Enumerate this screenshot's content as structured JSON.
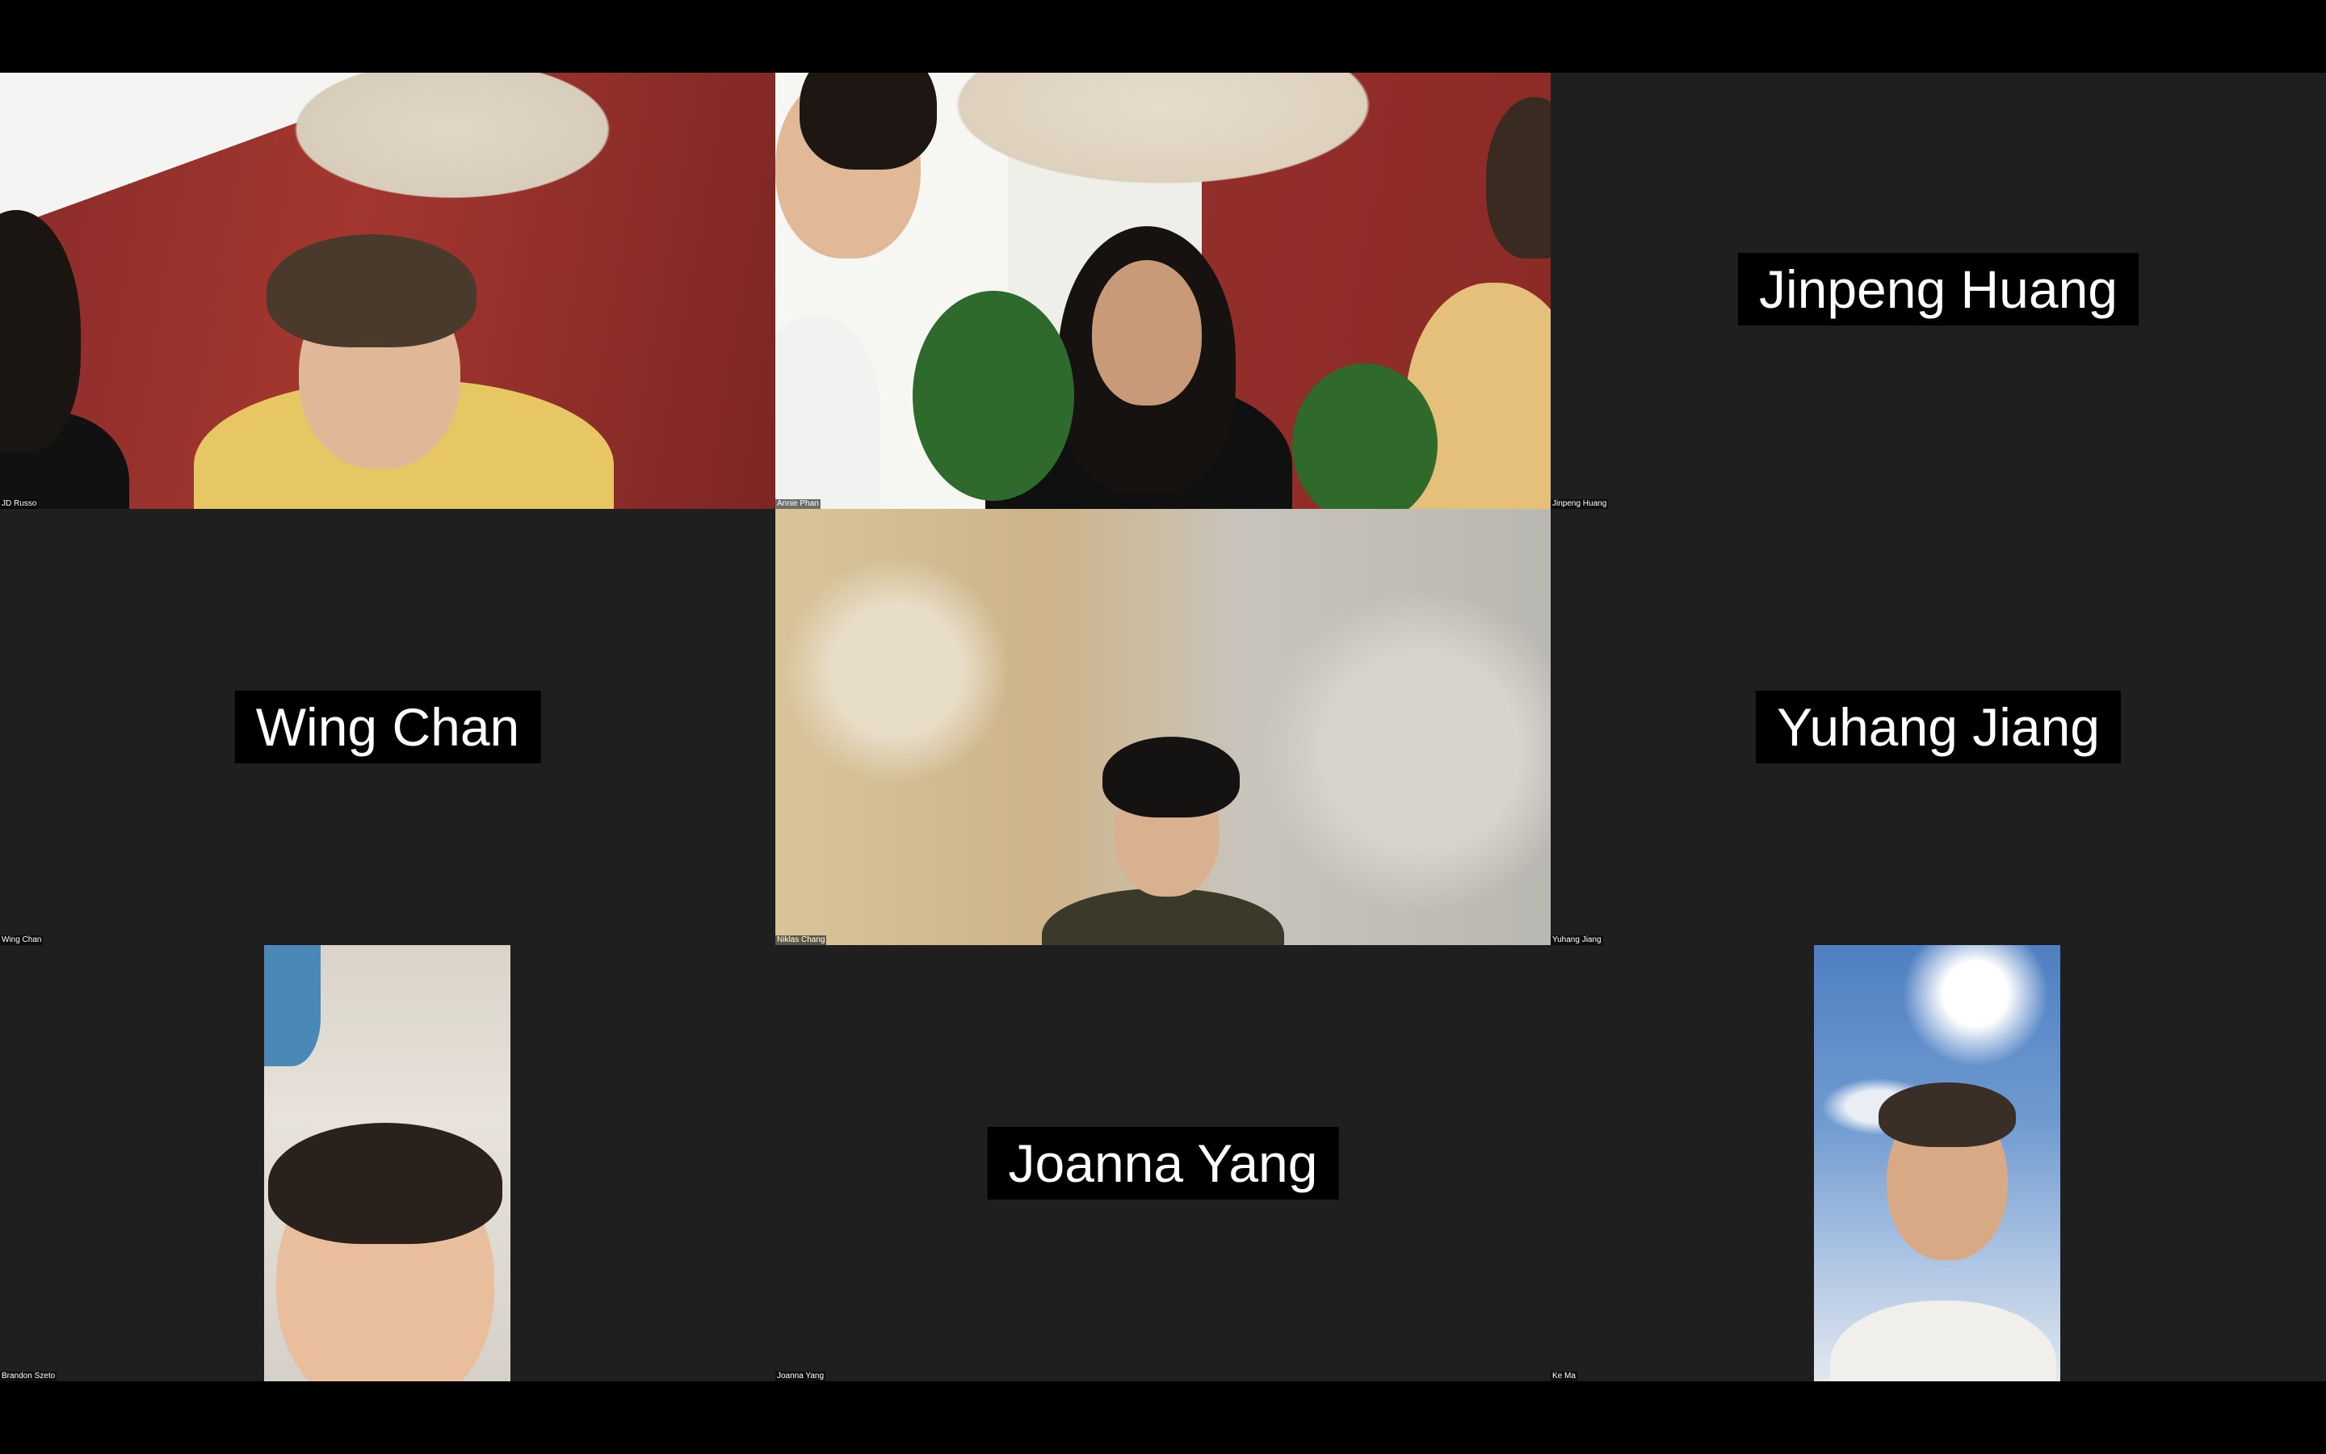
{
  "participants": [
    {
      "name": "JD Russo",
      "video": true
    },
    {
      "name": "Annie Phan",
      "video": true
    },
    {
      "name": "Jinpeng Huang",
      "video": false,
      "card": "Jinpeng Huang"
    },
    {
      "name": "Wing Chan",
      "video": false,
      "card": "Wing Chan"
    },
    {
      "name": "Niklas Chang",
      "video": true
    },
    {
      "name": "Yuhang Jiang",
      "video": false,
      "card": "Yuhang Jiang"
    },
    {
      "name": "Brandon Szeto",
      "video": true
    },
    {
      "name": "Joanna Yang",
      "video": false,
      "card": "Joanna Yang"
    },
    {
      "name": "Ke Ma",
      "video": true
    }
  ],
  "colors": {
    "background": "#000000",
    "tile": "#1f1f1f",
    "text": "#ffffff"
  }
}
